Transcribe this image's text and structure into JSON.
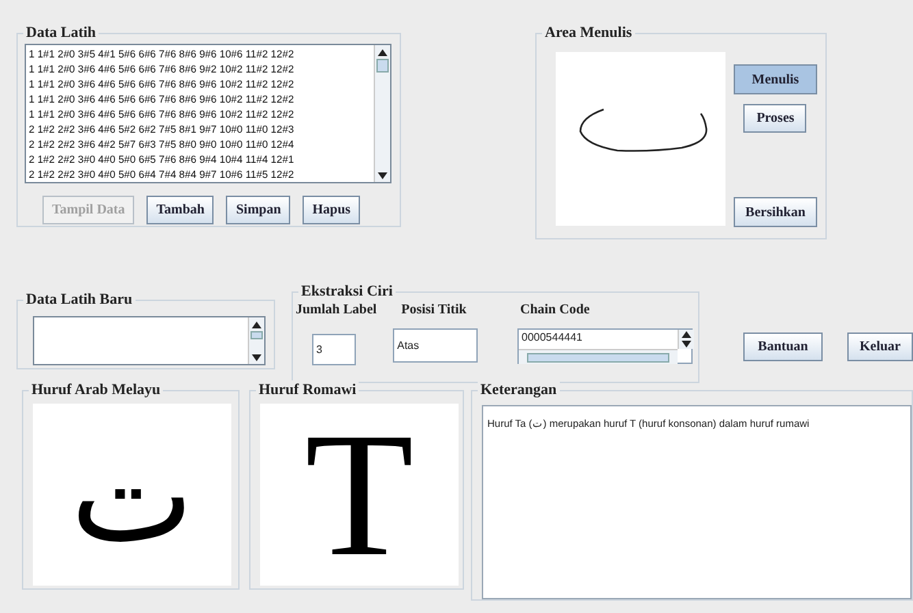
{
  "data_latih": {
    "title": "Data Latih",
    "lines": [
      "1 1#1 2#0 3#5 4#1 5#6 6#6 7#6 8#6 9#6 10#6 11#2 12#2",
      "1 1#1 2#0 3#6 4#6 5#6 6#6 7#6 8#6 9#2 10#2 11#2 12#2",
      "1 1#1 2#0 3#6 4#6 5#6 6#6 7#6 8#6 9#6 10#2 11#2 12#2",
      "1 1#1 2#0 3#6 4#6 5#6 6#6 7#6 8#6 9#6 10#2 11#2 12#2",
      "1 1#1 2#0 3#6 4#6 5#6 6#6 7#6 8#6 9#6 10#2 11#2 12#2",
      "2 1#2 2#2 3#6 4#6 5#2 6#2 7#5 8#1 9#7 10#0 11#0 12#3",
      "2 1#2 2#2 3#6 4#2 5#7 6#3 7#5 8#0 9#0 10#0 11#0 12#4",
      "2 1#2 2#2 3#0 4#0 5#0 6#5 7#6 8#6 9#4 10#4 11#4 12#1",
      "2 1#2 2#2 3#0 4#0 5#0 6#4 7#4 8#4 9#7 10#6 11#5 12#2"
    ],
    "buttons": [
      {
        "label": "Tampil Data",
        "disabled": true
      },
      {
        "label": "Tambah",
        "disabled": false
      },
      {
        "label": "Simpan",
        "disabled": false
      },
      {
        "label": "Hapus",
        "disabled": false
      }
    ]
  },
  "area_menulis": {
    "title": "Area Menulis",
    "buttons": [
      {
        "label": "Menulis",
        "selected": true
      },
      {
        "label": "Proses",
        "selected": false
      },
      {
        "label": "Bersihkan",
        "selected": false
      }
    ]
  },
  "data_latih_baru": {
    "title": "Data Latih Baru"
  },
  "ekstraksi_ciri": {
    "title": "Ekstraksi Ciri",
    "jumlah_label": {
      "label": "Jumlah Label",
      "value": "3"
    },
    "posisi_titik": {
      "label": "Posisi Titik",
      "value": "Atas"
    },
    "chain_code": {
      "label": "Chain Code",
      "value": "0000544441"
    }
  },
  "actions": [
    "Bantuan",
    "Keluar"
  ],
  "huruf_arab": {
    "title": "Huruf Arab Melayu",
    "glyph": "ت"
  },
  "huruf_romawi": {
    "title": "Huruf Romawi",
    "glyph": "T"
  },
  "keterangan": {
    "title": "Keterangan",
    "text": "Huruf Ta (ت) merupakan huruf T (huruf konsonan) dalam huruf rumawi"
  }
}
